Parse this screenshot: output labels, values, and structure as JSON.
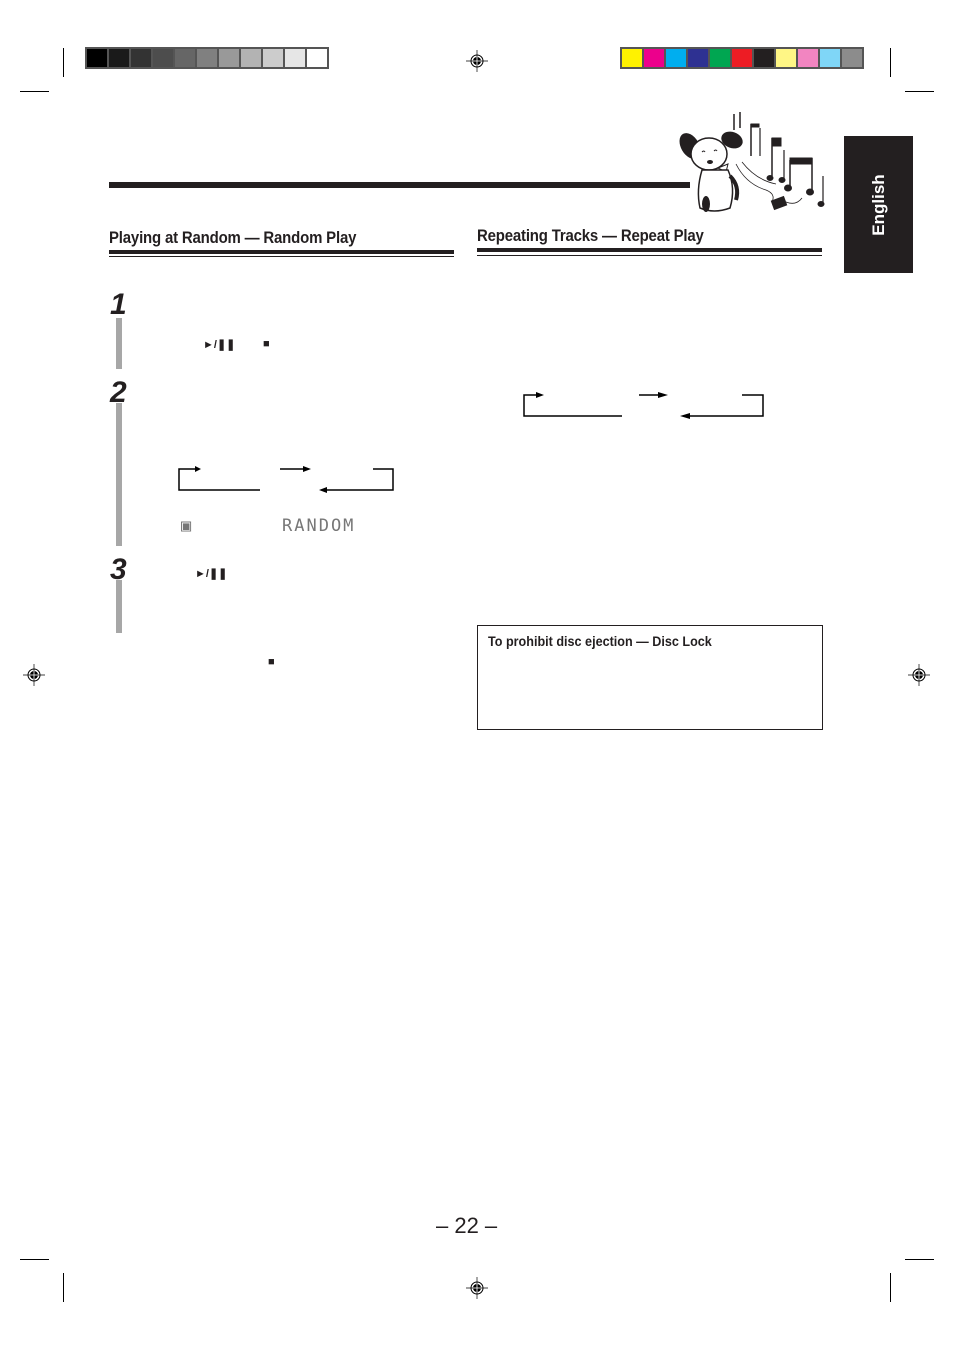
{
  "print_marks": {
    "grayscale_swatches": [
      "#000000",
      "#1a1a1a",
      "#333333",
      "#4d4d4d",
      "#666666",
      "#808080",
      "#999999",
      "#b3b3b3",
      "#cccccc",
      "#e6e6e6",
      "#ffffff"
    ],
    "color_swatches": [
      "#fff200",
      "#ec008c",
      "#00aeef",
      "#2e3192",
      "#00a651",
      "#ed1c24",
      "#231f20",
      "#fff685",
      "#f285c1",
      "#7fd6f7",
      "#8c8c8c"
    ]
  },
  "language_tab": {
    "label": "English"
  },
  "left_section": {
    "title": "Playing at Random — Random Play",
    "steps": [
      {
        "number": "1",
        "icons": [
          "play-pause",
          "stop"
        ],
        "play_pause_glyph": "►/❚❚",
        "stop_glyph": "■"
      },
      {
        "number": "2",
        "display_disc": "▣",
        "display_text": "RANDOM"
      },
      {
        "number": "3",
        "play_pause_glyph": "►/❚❚"
      }
    ],
    "footer_stop_glyph": "■"
  },
  "right_section": {
    "title": "Repeating Tracks — Repeat Play"
  },
  "disc_lock_box": {
    "title": "To prohibit disc ejection — Disc Lock"
  },
  "page_number": "– 22 –"
}
